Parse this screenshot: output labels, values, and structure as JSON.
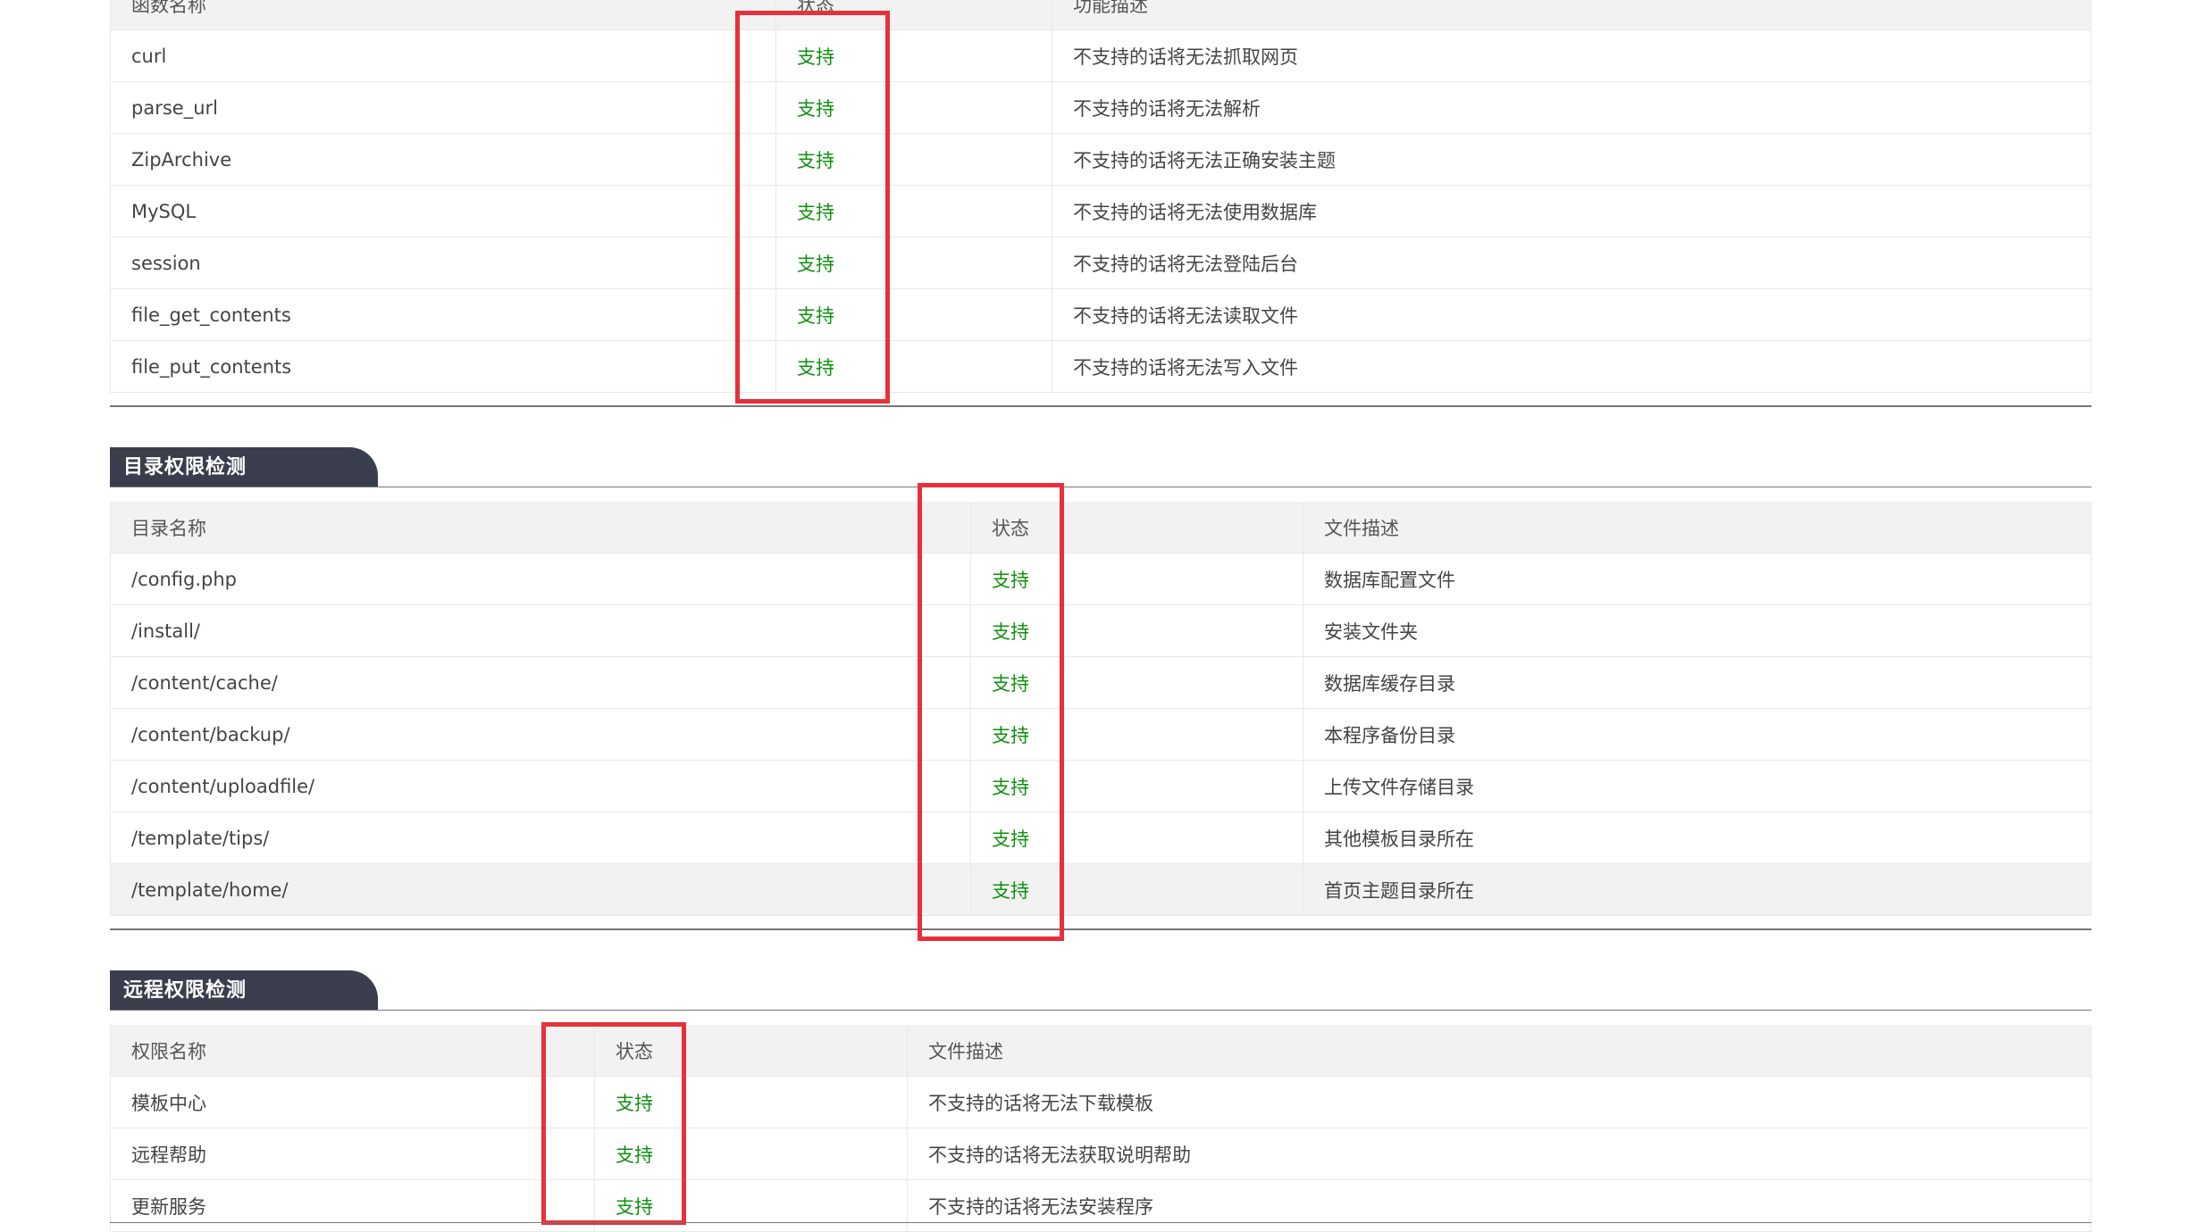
{
  "function_check": {
    "headers": [
      "函数名称",
      "状态",
      "功能描述"
    ],
    "rows": [
      {
        "name": "curl",
        "status": "支持",
        "desc": "不支持的话将无法抓取网页"
      },
      {
        "name": "parse_url",
        "status": "支持",
        "desc": "不支持的话将无法解析"
      },
      {
        "name": "ZipArchive",
        "status": "支持",
        "desc": "不支持的话将无法正确安装主题"
      },
      {
        "name": "MySQL",
        "status": "支持",
        "desc": "不支持的话将无法使用数据库"
      },
      {
        "name": "session",
        "status": "支持",
        "desc": "不支持的话将无法登陆后台"
      },
      {
        "name": "file_get_contents",
        "status": "支持",
        "desc": "不支持的话将无法读取文件"
      },
      {
        "name": "file_put_contents",
        "status": "支持",
        "desc": "不支持的话将无法写入文件"
      }
    ]
  },
  "dir_check": {
    "title": "目录权限检测",
    "headers": [
      "目录名称",
      "状态",
      "文件描述"
    ],
    "rows": [
      {
        "name": "/config.php",
        "status": "支持",
        "desc": "数据库配置文件"
      },
      {
        "name": "/install/",
        "status": "支持",
        "desc": "安装文件夹"
      },
      {
        "name": "/content/cache/",
        "status": "支持",
        "desc": "数据库缓存目录"
      },
      {
        "name": "/content/backup/",
        "status": "支持",
        "desc": "本程序备份目录"
      },
      {
        "name": "/content/uploadfile/",
        "status": "支持",
        "desc": "上传文件存储目录"
      },
      {
        "name": "/template/tips/",
        "status": "支持",
        "desc": "其他模板目录所在"
      },
      {
        "name": "/template/home/",
        "status": "支持",
        "desc": "首页主题目录所在"
      }
    ]
  },
  "remote_check": {
    "title": "远程权限检测",
    "headers": [
      "权限名称",
      "状态",
      "文件描述"
    ],
    "rows": [
      {
        "name": "模板中心",
        "status": "支持",
        "desc": "不支持的话将无法下载模板"
      },
      {
        "name": "远程帮助",
        "status": "支持",
        "desc": "不支持的话将无法获取说明帮助"
      },
      {
        "name": "更新服务",
        "status": "支持",
        "desc": "不支持的话将无法安装程序"
      }
    ]
  },
  "colors": {
    "ok": "#109010",
    "highlight_box": "#e8303a",
    "section_tab": "#3a3e4c"
  }
}
